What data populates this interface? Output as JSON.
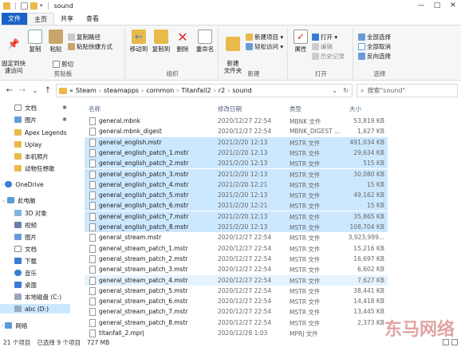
{
  "window": {
    "title": "sound",
    "controls": [
      "—",
      "□",
      "✕"
    ]
  },
  "tabs": {
    "file": "文件",
    "home": "主页",
    "share": "共享",
    "view": "查看"
  },
  "ribbon": {
    "clipboard": {
      "label": "剪贴板",
      "pin": "固定到快\n速访问",
      "copy": "复制",
      "paste": "粘贴",
      "copy_path": "复制路径",
      "paste_shortcut": "粘贴快捷方式",
      "cut": "剪切"
    },
    "organize": {
      "label": "组织",
      "move_to": "移动到",
      "copy_to": "复制到",
      "delete": "删除",
      "rename": "重命名"
    },
    "new": {
      "label": "新建",
      "new_folder": "新建\n文件夹",
      "new_item": "新建项目 ▾",
      "easy_access": "轻松访问 ▾"
    },
    "open": {
      "label": "打开",
      "properties": "属性",
      "open": "打开 ▾",
      "edit": "编辑",
      "history": "历史记录"
    },
    "select": {
      "label": "选择",
      "select_all": "全部选择",
      "select_none": "全部取消",
      "invert": "反向选择"
    }
  },
  "address": {
    "back": "←",
    "forward": "→",
    "up_recent": "⌄",
    "up": "↑",
    "breadcrumbs": [
      "«",
      "Steam",
      "steamapps",
      "common",
      "Titanfall2",
      "r2",
      "sound"
    ],
    "dropdown": "⌄",
    "refresh": "↻",
    "search_placeholder": "搜索\"sound\""
  },
  "nav": {
    "items": [
      {
        "label": "文档",
        "pinned": true
      },
      {
        "label": "图片",
        "pinned": true
      },
      {
        "label": "Apex Legends",
        "pinned": false
      },
      {
        "label": "Uplay",
        "pinned": false
      },
      {
        "label": "本机照片",
        "pinned": false
      },
      {
        "label": "动物狂想歌",
        "pinned": false
      },
      {
        "label": "OneDrive",
        "pinned": false
      },
      {
        "label": "此电脑",
        "pinned": false
      },
      {
        "label": "3D 对象",
        "pinned": false
      },
      {
        "label": "视频",
        "pinned": false
      },
      {
        "label": "图片",
        "pinned": false
      },
      {
        "label": "文档",
        "pinned": false
      },
      {
        "label": "下载",
        "pinned": false
      },
      {
        "label": "音乐",
        "pinned": false
      },
      {
        "label": "桌面",
        "pinned": false
      },
      {
        "label": "本地磁盘 (C:)",
        "pinned": false
      },
      {
        "label": "abc (D:)",
        "pinned": false
      },
      {
        "label": "网络",
        "pinned": false
      }
    ]
  },
  "columns": {
    "name": "名称",
    "date": "修改日期",
    "type": "类型",
    "size": "大小"
  },
  "files": [
    {
      "name": "general.mbnk",
      "date": "2020/12/27 22:54",
      "type": "MBNK 文件",
      "size": "53,819 KB",
      "selected": false
    },
    {
      "name": "general.mbnk_digest",
      "date": "2020/12/27 22:54",
      "type": "MBNK_DIGEST ...",
      "size": "1,627 KB",
      "selected": false
    },
    {
      "name": "general_english.mstr",
      "date": "2021/2/20 12:13",
      "type": "MSTR 文件",
      "size": "491,034 KB",
      "selected": true
    },
    {
      "name": "general_english_patch_1.mstr",
      "date": "2021/2/20 12:13",
      "type": "MSTR 文件",
      "size": "29,634 KB",
      "selected": true
    },
    {
      "name": "general_english_patch_2.mstr",
      "date": "2021/2/20 12:13",
      "type": "MSTR 文件",
      "size": "515 KB",
      "selected": true
    },
    {
      "name": "general_english_patch_3.mstr",
      "date": "2021/2/20 12:13",
      "type": "MSTR 文件",
      "size": "30,080 KB",
      "selected": true
    },
    {
      "name": "general_english_patch_4.mstr",
      "date": "2021/2/20 12:21",
      "type": "MSTR 文件",
      "size": "15 KB",
      "selected": true
    },
    {
      "name": "general_english_patch_5.mstr",
      "date": "2021/2/20 12:13",
      "type": "MSTR 文件",
      "size": "49,162 KB",
      "selected": true
    },
    {
      "name": "general_english_patch_6.mstr",
      "date": "2021/2/20 12:21",
      "type": "MSTR 文件",
      "size": "15 KB",
      "selected": true
    },
    {
      "name": "general_english_patch_7.mstr",
      "date": "2021/2/20 12:13",
      "type": "MSTR 文件",
      "size": "35,865 KB",
      "selected": true
    },
    {
      "name": "general_english_patch_8.mstr",
      "date": "2021/2/20 12:13",
      "type": "MSTR 文件",
      "size": "108,704 KB",
      "selected": true
    },
    {
      "name": "general_stream.mstr",
      "date": "2020/12/27 22:54",
      "type": "MSTR 文件",
      "size": "3,923,999...",
      "selected": false
    },
    {
      "name": "general_stream_patch_1.mstr",
      "date": "2020/12/27 22:54",
      "type": "MSTR 文件",
      "size": "15,216 KB",
      "selected": false
    },
    {
      "name": "general_stream_patch_2.mstr",
      "date": "2020/12/27 22:54",
      "type": "MSTR 文件",
      "size": "16,697 KB",
      "selected": false
    },
    {
      "name": "general_stream_patch_3.mstr",
      "date": "2020/12/27 22:54",
      "type": "MSTR 文件",
      "size": "6,602 KB",
      "selected": false
    },
    {
      "name": "general_stream_patch_4.mstr",
      "date": "2020/12/27 22:54",
      "type": "MSTR 文件",
      "size": "7,627 KB",
      "selected": "hover"
    },
    {
      "name": "general_stream_patch_5.mstr",
      "date": "2020/12/27 22:54",
      "type": "MSTR 文件",
      "size": "38,441 KB",
      "selected": false
    },
    {
      "name": "general_stream_patch_6.mstr",
      "date": "2020/12/27 22:54",
      "type": "MSTR 文件",
      "size": "14,418 KB",
      "selected": false
    },
    {
      "name": "general_stream_patch_7.mstr",
      "date": "2020/12/27 22:54",
      "type": "MSTR 文件",
      "size": "13,445 KB",
      "selected": false
    },
    {
      "name": "general_stream_patch_8.mstr",
      "date": "2020/12/27 22:54",
      "type": "MSTR 文件",
      "size": "2,373 KB",
      "selected": false
    },
    {
      "name": "titanfall_2.mprj",
      "date": "2020/12/28 1:03",
      "type": "MPRJ 文件",
      "size": "",
      "selected": false
    }
  ],
  "status": {
    "count": "21 个项目",
    "selected": "已选择 9 个项目",
    "size": "727 MB"
  },
  "watermark": "东马网络",
  "colors": {
    "accent": "#1a62c7",
    "selected_bg": "#cce8ff",
    "folder": "#e9b949"
  }
}
